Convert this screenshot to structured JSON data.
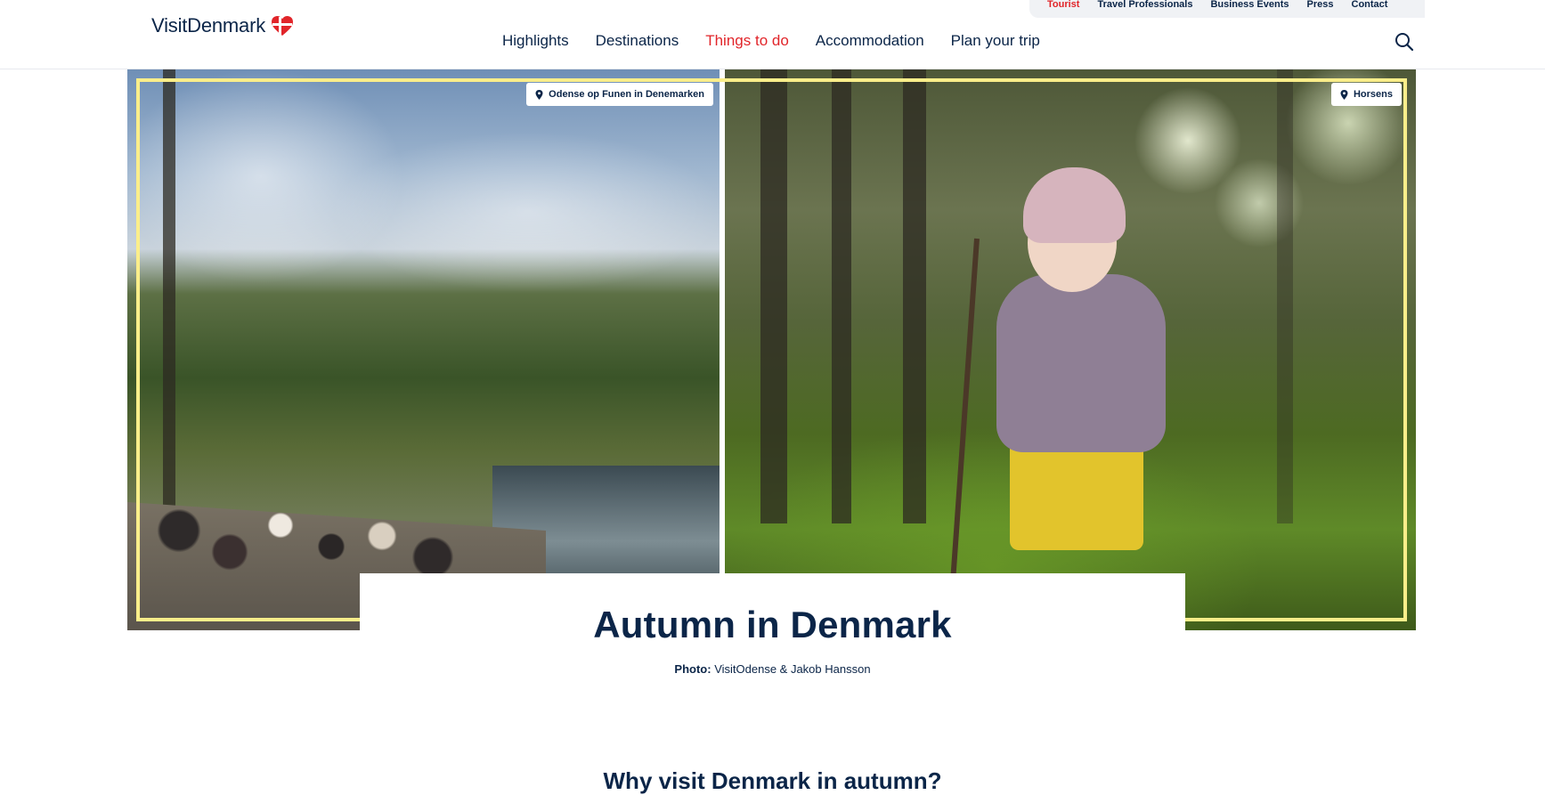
{
  "brand": {
    "logo_text": "VisitDenmark",
    "accent_color": "#e1252a",
    "text_color": "#0b2548"
  },
  "utility_nav": [
    {
      "label": "Tourist",
      "active": true
    },
    {
      "label": "Travel Professionals",
      "active": false
    },
    {
      "label": "Business Events",
      "active": false
    },
    {
      "label": "Press",
      "active": false
    },
    {
      "label": "Contact",
      "active": false
    }
  ],
  "main_nav": [
    {
      "label": "Highlights",
      "active": false
    },
    {
      "label": "Destinations",
      "active": false
    },
    {
      "label": "Things to do",
      "active": true
    },
    {
      "label": "Accommodation",
      "active": false
    },
    {
      "label": "Plan your trip",
      "active": false
    }
  ],
  "search": {
    "icon": "search-icon"
  },
  "hero": {
    "left_location": "Odense op Funen in Denemarken",
    "right_location": "Horsens",
    "frame_color": "#fbee8a"
  },
  "page": {
    "title": "Autumn in Denmark",
    "photo_credit_label": "Photo:",
    "photo_credit": "VisitOdense & Jakob Hansson",
    "section_heading": "Why visit Denmark in autumn?"
  }
}
